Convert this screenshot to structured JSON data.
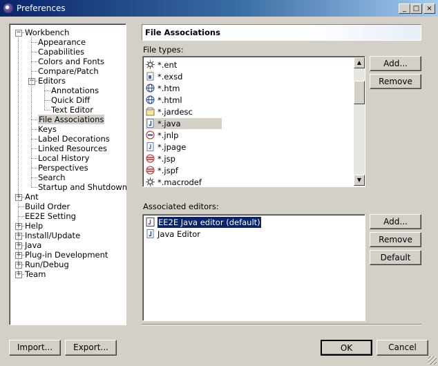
{
  "window": {
    "title": "Preferences"
  },
  "titlebar_buttons": [
    "_",
    "□",
    "×"
  ],
  "tree": {
    "items": [
      {
        "label": "Workbench",
        "level": 0,
        "expander": "−"
      },
      {
        "label": "Appearance",
        "level": 1
      },
      {
        "label": "Capabilities",
        "level": 1
      },
      {
        "label": "Colors and Fonts",
        "level": 1
      },
      {
        "label": "Compare/Patch",
        "level": 1
      },
      {
        "label": "Editors",
        "level": 1,
        "expander": "−"
      },
      {
        "label": "Annotations",
        "level": 2
      },
      {
        "label": "Quick Diff",
        "level": 2
      },
      {
        "label": "Text Editor",
        "level": 2
      },
      {
        "label": "File Associations",
        "level": 1,
        "selected": true
      },
      {
        "label": "Keys",
        "level": 1
      },
      {
        "label": "Label Decorations",
        "level": 1
      },
      {
        "label": "Linked Resources",
        "level": 1
      },
      {
        "label": "Local History",
        "level": 1
      },
      {
        "label": "Perspectives",
        "level": 1
      },
      {
        "label": "Search",
        "level": 1
      },
      {
        "label": "Startup and Shutdown",
        "level": 1
      },
      {
        "label": "Ant",
        "level": 0,
        "expander": "+"
      },
      {
        "label": "Build Order",
        "level": 0
      },
      {
        "label": "EE2E Setting",
        "level": 0
      },
      {
        "label": "Help",
        "level": 0,
        "expander": "+"
      },
      {
        "label": "Install/Update",
        "level": 0,
        "expander": "+"
      },
      {
        "label": "Java",
        "level": 0,
        "expander": "+"
      },
      {
        "label": "Plug-in Development",
        "level": 0,
        "expander": "+"
      },
      {
        "label": "Run/Debug",
        "level": 0,
        "expander": "+"
      },
      {
        "label": "Team",
        "level": 0,
        "expander": "+"
      }
    ]
  },
  "page": {
    "title": "File Associations",
    "file_types_label": "File types:",
    "file_types": [
      {
        "label": "*.ent",
        "icon": "gear-file-icon"
      },
      {
        "label": "*.exsd",
        "icon": "schema-file-icon"
      },
      {
        "label": "*.htm",
        "icon": "html-file-icon"
      },
      {
        "label": "*.html",
        "icon": "html-file-icon"
      },
      {
        "label": "*.jardesc",
        "icon": "jar-file-icon"
      },
      {
        "label": "*.java",
        "icon": "java-file-icon",
        "selected": true
      },
      {
        "label": "*.jnlp",
        "icon": "jnlp-file-icon"
      },
      {
        "label": "*.jpage",
        "icon": "jpage-file-icon"
      },
      {
        "label": "*.jsp",
        "icon": "jsp-file-icon"
      },
      {
        "label": "*.jspf",
        "icon": "jsp-file-icon"
      },
      {
        "label": "*.macrodef",
        "icon": "gear-file-icon"
      }
    ],
    "add_label": "Add...",
    "remove_label": "Remove",
    "associated_editors_label": "Associated editors:",
    "editors": [
      {
        "label": "EE2E Java editor (default)",
        "icon": "ee2e-editor-icon",
        "selected": true
      },
      {
        "label": "Java Editor",
        "icon": "java-file-icon"
      }
    ],
    "editor_add_label": "Add...",
    "editor_remove_label": "Remove",
    "default_label": "Default"
  },
  "footer": {
    "import_label": "Import...",
    "export_label": "Export...",
    "ok_label": "OK",
    "cancel_label": "Cancel"
  },
  "colors": {
    "titlebar_start": "#0a246a",
    "selection": "#0a246a",
    "dialog_bg": "#d4d0c8"
  }
}
